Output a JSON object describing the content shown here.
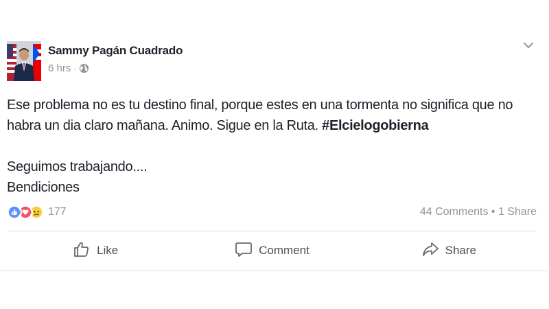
{
  "post": {
    "author_name": "Sammy Pagán Cuadrado",
    "timestamp": "6 hrs",
    "separator": "·",
    "privacy_icon": "globe-icon",
    "menu_icon": "chevron-down-icon",
    "body_line1": "Ese problema no es tu destino final, porque estes en una tormenta no significa que no habra un dia claro mañana. Animo. Sigue en la Ruta. ",
    "hashtag": "#Elcielogobierna",
    "body_line2": "Seguimos trabajando....",
    "body_line3": "Bendiciones"
  },
  "stats": {
    "reactions": [
      "like-reaction-icon",
      "love-reaction-icon",
      "sad-reaction-icon"
    ],
    "reaction_count": "177",
    "comments": "44 Comments",
    "dot": " • ",
    "shares": "1 Share"
  },
  "actions": {
    "like_label": "Like",
    "comment_label": "Comment",
    "share_label": "Share"
  },
  "colors": {
    "like_blue": "#5890ff",
    "love_red": "#f25268",
    "sad_yellow": "#fbcd3c",
    "meta_gray": "#90949c",
    "action_gray": "#4b4f56"
  }
}
